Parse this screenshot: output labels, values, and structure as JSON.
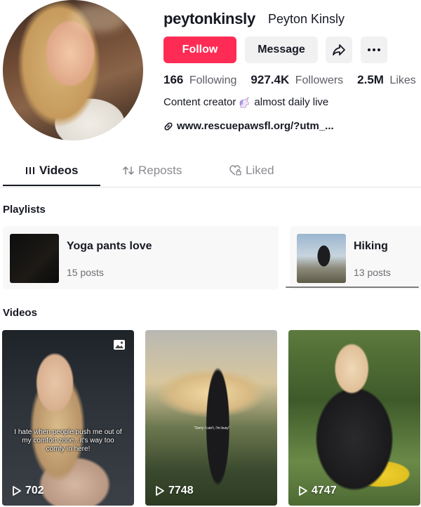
{
  "profile": {
    "username": "peytonkinsly",
    "display_name": "Peyton Kinsly",
    "follow_label": "Follow",
    "message_label": "Message",
    "stats": {
      "following_count": "166",
      "following_label": "Following",
      "followers_count": "927.4K",
      "followers_label": "Followers",
      "likes_count": "2.5M",
      "likes_label": "Likes"
    },
    "bio_before": "Content creator",
    "bio_after": "almost daily live",
    "link": "www.rescuepawsfl.org/?utm_..."
  },
  "tabs": {
    "videos": "Videos",
    "reposts": "Reposts",
    "liked": "Liked"
  },
  "playlists": {
    "title": "Playlists",
    "items": [
      {
        "name": "Yoga pants love",
        "count": "15 posts"
      },
      {
        "name": "Hiking",
        "count": "13 posts"
      }
    ]
  },
  "videos": {
    "title": "Videos",
    "items": [
      {
        "views": "702",
        "caption": "I hate when people push me out of my comfort zone...it's way too comfy in here!"
      },
      {
        "views": "7748",
        "caption": "\"Sorry I can't, I'm busy\""
      },
      {
        "views": "4747"
      }
    ]
  },
  "colors": {
    "accent": "#fe2c55",
    "text": "#161823",
    "muted": "#8a8b91"
  }
}
